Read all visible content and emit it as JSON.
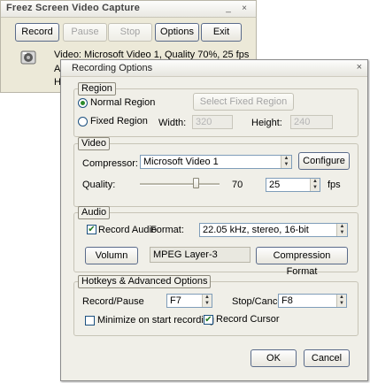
{
  "main_window": {
    "title": "Freez Screen Video Capture",
    "controls": {
      "minimize": "_",
      "close": "×"
    },
    "buttons": {
      "record": "Record",
      "pause": "Pause",
      "stop": "Stop",
      "options": "Options",
      "exit": "Exit"
    },
    "status_video": "Video: Microsoft Video 1, Quality 70%, 25 fps",
    "status_audio_partial": "Au",
    "status_hotkeys_partial": "Ho"
  },
  "dialog": {
    "title": "Recording Options",
    "close": "×",
    "region": {
      "legend": "Region",
      "normal_label": "Normal Region",
      "fixed_label": "Fixed Region",
      "normal_selected": true,
      "select_button": "Select Fixed Region",
      "width_label": "Width:",
      "width_value": "320",
      "height_label": "Height:",
      "height_value": "240"
    },
    "video": {
      "legend": "Video",
      "compressor_label": "Compressor:",
      "compressor_value": "Microsoft Video 1",
      "configure_button": "Configure",
      "quality_label": "Quality:",
      "quality_value": "70",
      "quality_level_percent": 70,
      "fps_value": "25",
      "fps_label": "fps"
    },
    "audio": {
      "legend": "Audio",
      "record_audio_label": "Record Audio",
      "record_audio_checked": true,
      "format_label": "Format:",
      "format_value": "22.05 kHz, stereo, 16-bit",
      "volume_button": "Volumn",
      "codec_value": "MPEG Layer-3",
      "compression_button": "Compression Format"
    },
    "hotkeys": {
      "legend": "Hotkeys & Advanced Options",
      "record_pause_label": "Record/Pause",
      "record_pause_value": "F7",
      "stop_cancel_label": "Stop/Cancel",
      "stop_cancel_value": "F8",
      "minimize_label": "Minimize on start recording",
      "minimize_checked": false,
      "record_cursor_label": "Record Cursor",
      "record_cursor_checked": true
    },
    "ok_button": "OK",
    "cancel_button": "Cancel"
  }
}
